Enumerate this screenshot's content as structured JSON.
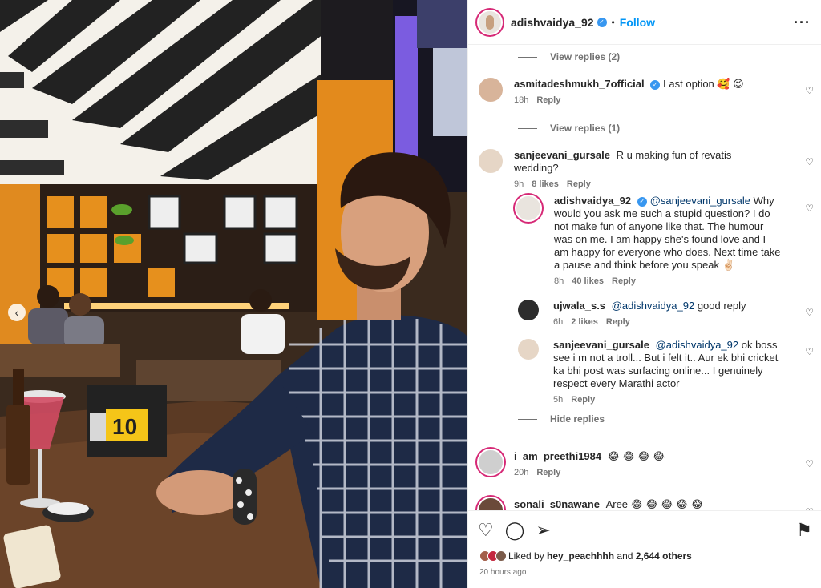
{
  "header": {
    "username": "adishvaidya_92",
    "separator": "•",
    "follow_label": "Follow",
    "more_icon": "more-horizontal-icon"
  },
  "photo": {
    "table_number": "10",
    "carousel_prev_icon": "chevron-left-icon"
  },
  "comments": {
    "view_replies_top": "View replies (2)",
    "c1": {
      "username": "asmitadeshmukh_7official",
      "text": "Last option 🥰 😉",
      "time": "18h",
      "reply": "Reply"
    },
    "view_replies_c1": "View replies (1)",
    "c2": {
      "username": "sanjeevani_gursale",
      "text": "R u making fun of revatis wedding?",
      "time": "9h",
      "likes": "8 likes",
      "reply": "Reply"
    },
    "r1": {
      "username": "adishvaidya_92",
      "mention": "@sanjeevani_gursale",
      "text": " Why would you ask me such a stupid question? I do not make fun of anyone like that. The humour was on me. I am happy she's found love and I am happy for everyone who does. Next time take a pause and think before you speak ✌🏻",
      "time": "8h",
      "likes": "40 likes",
      "reply": "Reply"
    },
    "r2": {
      "username": "ujwala_s.s",
      "mention": "@adishvaidya_92",
      "text": " good reply",
      "time": "6h",
      "likes": "2 likes",
      "reply": "Reply"
    },
    "r3": {
      "username": "sanjeevani_gursale",
      "mention": "@adishvaidya_92",
      "text": " ok boss see i m not a troll... But i felt it.. Aur ek bhi cricket ka bhi post was surfacing online... I genuinely respect every Marathi actor",
      "time": "5h",
      "reply": "Reply"
    },
    "hide_replies": "Hide replies",
    "c3": {
      "username": "i_am_preethi1984",
      "text": "😂 😂 😂 😂",
      "time": "20h",
      "reply": "Reply"
    },
    "c4": {
      "username": "sonali_s0nawane",
      "text": "Aree 😂 😂 😂 😂 😂"
    }
  },
  "footer": {
    "liked_prefix": "Liked by",
    "liked_user": "hey_peachhhh",
    "liked_and": "and",
    "liked_others": "2,644 others",
    "time_ago": "20 hours ago"
  },
  "colors": {
    "follow": "#0095f6",
    "verified": "#3897f0",
    "story_ring": "#d62976",
    "mention": "#00376b"
  }
}
